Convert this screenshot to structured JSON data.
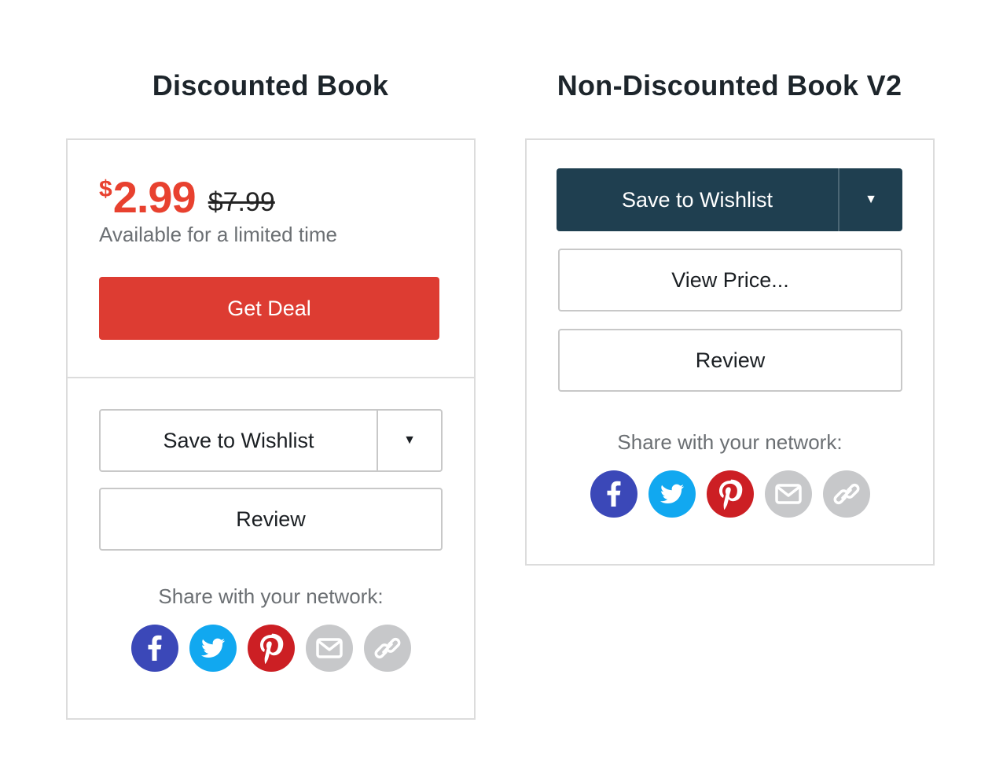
{
  "left": {
    "title": "Discounted Book",
    "price_symbol": "$",
    "price_now": "2.99",
    "price_old": "$7.99",
    "availability": "Available for a limited time",
    "deal_button": "Get Deal",
    "wishlist_button": "Save to Wishlist",
    "review_button": "Review",
    "share_label": "Share with your network:"
  },
  "right": {
    "title": "Non-Discounted Book V2",
    "wishlist_button": "Save to Wishlist",
    "view_price_button": "View Price...",
    "review_button": "Review",
    "share_label": "Share with your network:"
  },
  "icons": {
    "caret": "▼",
    "social": [
      "facebook-icon",
      "twitter-icon",
      "pinterest-icon",
      "email-icon",
      "link-icon"
    ]
  },
  "colors": {
    "sale_price": "#e8412f",
    "deal_button": "#dd3c32",
    "dark_button": "#1f3f50",
    "facebook": "#3b48b8",
    "twitter": "#11a8f0",
    "pinterest": "#cc1f24",
    "neutral_icon": "#c7c8ca"
  }
}
